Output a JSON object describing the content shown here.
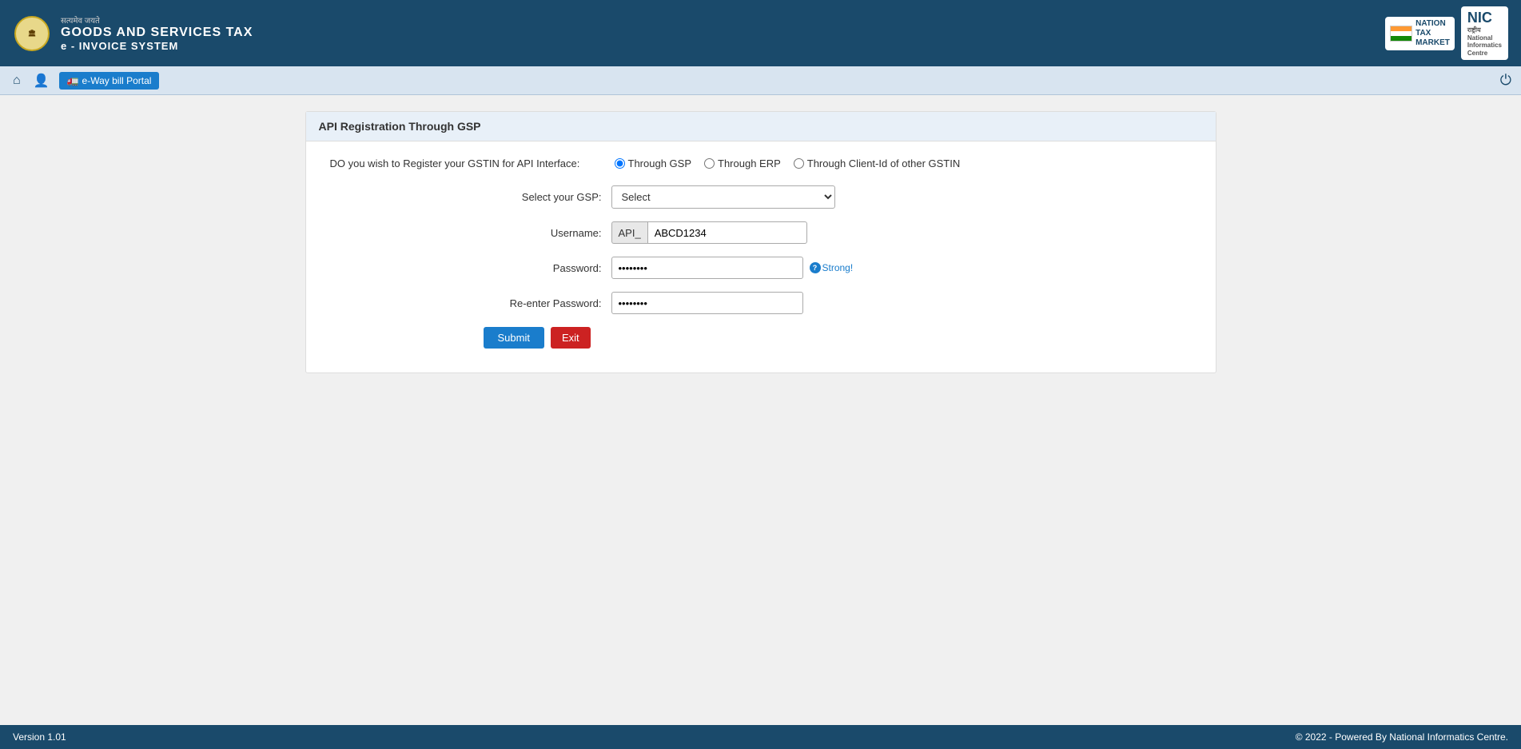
{
  "header": {
    "title_main": "GOODS AND SERVICES TAX",
    "title_sub": "e - INVOICE SYSTEM",
    "satyameva": "सत्यमेव जयते",
    "ntm_label": "NATION\nTAX\nMARKET",
    "nic_label": "NIC",
    "nic_sublabel": "राष्ट्रीय\nNational\nInformatics\nCentre"
  },
  "navbar": {
    "home_icon": "⌂",
    "user_icon": "👤",
    "eway_bill_label": "e-Way bill Portal",
    "power_icon": "⏻"
  },
  "form": {
    "card_title": "API Registration Through GSP",
    "registration_type_label": "DO you wish to Register your GSTIN for API Interface:",
    "radio_options": [
      {
        "id": "through_gsp",
        "label": "Through GSP",
        "checked": true
      },
      {
        "id": "through_erp",
        "label": "Through ERP",
        "checked": false
      },
      {
        "id": "through_client",
        "label": "Through Client-Id of other GSTIN",
        "checked": false
      }
    ],
    "gsp_select_label": "Select your GSP:",
    "gsp_select_placeholder": "Select",
    "gsp_options": [
      "Select"
    ],
    "username_label": "Username:",
    "username_prefix": "API_",
    "username_value": "ABCD1234",
    "password_label": "Password:",
    "password_value": "••••••••",
    "password_strength": "Strong!",
    "reenter_password_label": "Re-enter Password:",
    "reenter_password_value": "••••••••",
    "submit_label": "Submit",
    "exit_label": "Exit"
  },
  "footer": {
    "version": "Version 1.01",
    "copyright": "© 2022 - Powered By National Informatics Centre."
  }
}
